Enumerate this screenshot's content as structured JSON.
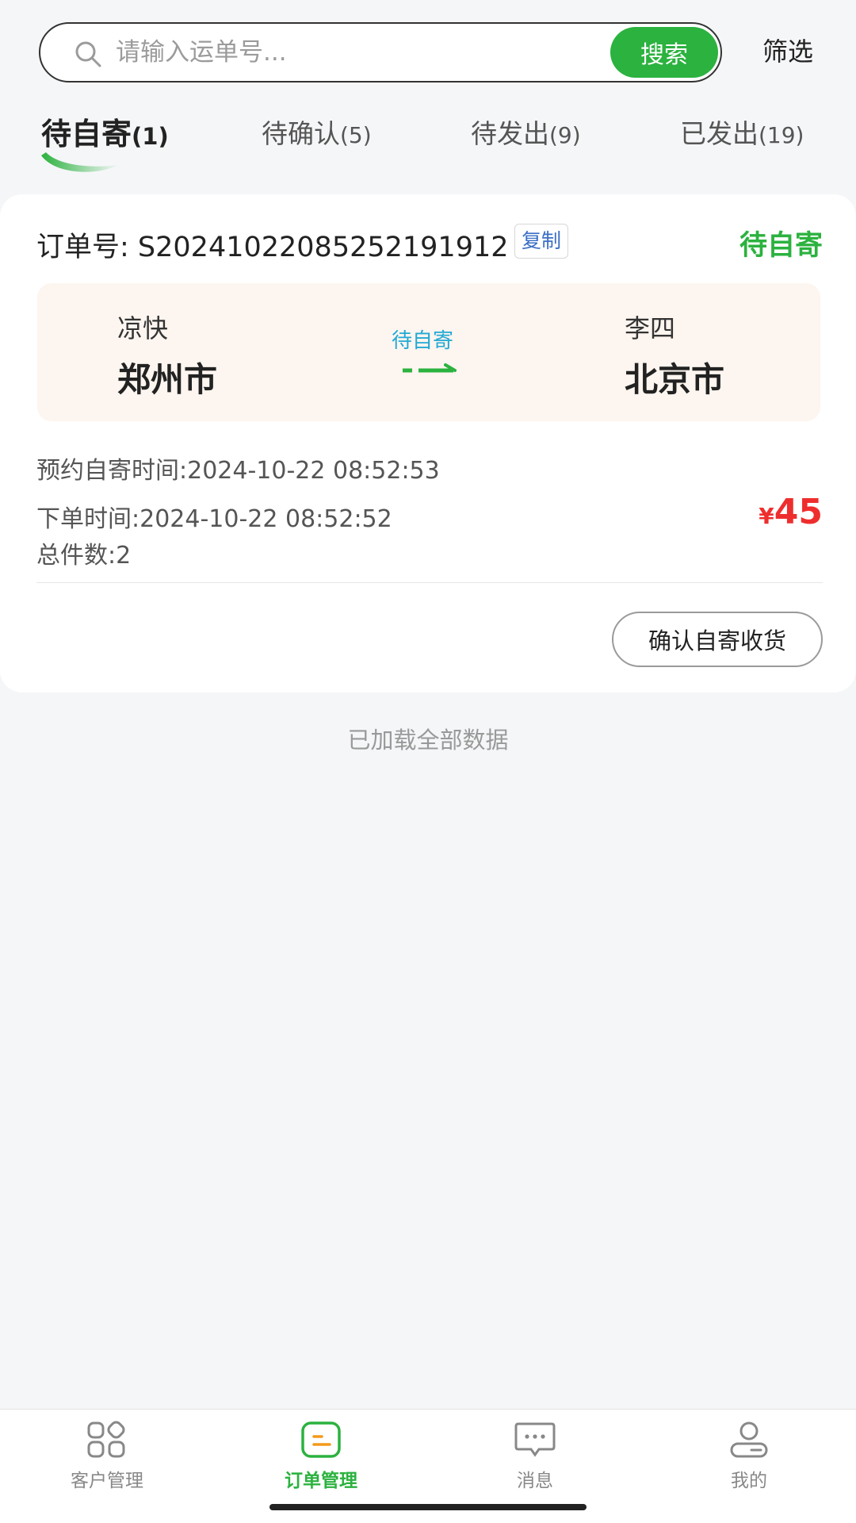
{
  "search": {
    "placeholder": "请输入运单号...",
    "button_label": "搜索",
    "filter_label": "筛选"
  },
  "tabs": [
    {
      "label": "待自寄",
      "count": "(1)",
      "active": true
    },
    {
      "label": "待确认",
      "count": "(5)",
      "active": false
    },
    {
      "label": "待发出",
      "count": "(9)",
      "active": false
    },
    {
      "label": "已发出",
      "count": "(19)",
      "active": false
    }
  ],
  "order": {
    "order_no_text": "订单号: S20241022085252191912",
    "copy_label": "复制",
    "status": "待自寄",
    "sender_name": "凉快",
    "sender_city": "郑州市",
    "route_status": "待自寄",
    "receiver_name": "李四",
    "receiver_city": "北京市",
    "appointment_time": "预约自寄时间:2024-10-22 08:52:53",
    "order_time": "下单时间:2024-10-22 08:52:52",
    "total_pieces": "总件数:2",
    "currency": "¥",
    "price": "45",
    "confirm_label": "确认自寄收货"
  },
  "list_footer": "已加载全部数据",
  "bottom_nav": [
    {
      "label": "客户管理",
      "icon": "grid-icon",
      "active": false
    },
    {
      "label": "订单管理",
      "icon": "order-icon",
      "active": true
    },
    {
      "label": "消息",
      "icon": "chat-icon",
      "active": false
    },
    {
      "label": "我的",
      "icon": "user-icon",
      "active": false
    }
  ],
  "colors": {
    "accent_green": "#2bb23f",
    "price_red": "#ee2e2e",
    "route_blue": "#22a9d4",
    "route_bg": "#fdf5ef",
    "icon_orange": "#f39a1b"
  }
}
